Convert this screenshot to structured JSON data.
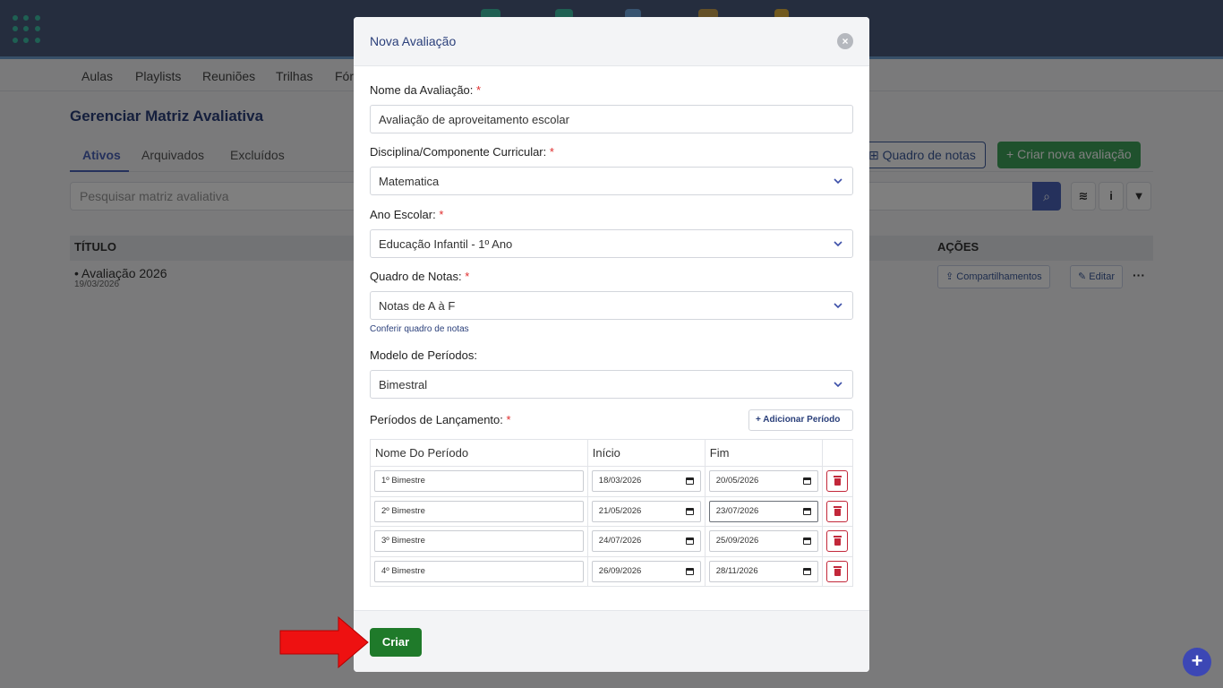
{
  "background": {
    "subnav": [
      "Aulas",
      "Playlists",
      "Reuniões",
      "Trilhas",
      "Fór"
    ],
    "page_title": "Gerenciar Matriz Avaliativa",
    "tabs": [
      "Ativos",
      "Arquivados",
      "Excluídos"
    ],
    "buttons": {
      "grade_board": "Quadro de notas",
      "create_new": "Criar nova avaliação"
    },
    "search_placeholder": "Pesquisar matriz avaliativa",
    "table": {
      "col_title": "TÍTULO",
      "col_actions": "AÇÕES",
      "rows": [
        {
          "title": "Avaliação 2026",
          "date": "19/03/2026",
          "share": "Compartilhamentos",
          "edit": "Editar"
        }
      ]
    }
  },
  "modal": {
    "title": "Nova Avaliação",
    "fields": {
      "name": {
        "label": "Nome da Avaliação:",
        "value": "Avaliação de aproveitamento escolar"
      },
      "discipline": {
        "label": "Disciplina/Componente Curricular:",
        "value": "Matematica"
      },
      "grade": {
        "label": "Ano Escolar:",
        "value": "Educação Infantil - 1º Ano"
      },
      "grade_board": {
        "label": "Quadro de Notas:",
        "value": "Notas de A à F",
        "link": "Conferir quadro de notas"
      },
      "period_model": {
        "label": "Modelo de Períodos:",
        "value": "Bimestral"
      }
    },
    "periods": {
      "label": "Períodos de Lançamento:",
      "add_button": "Adicionar Período",
      "headers": [
        "Nome Do Período",
        "Início",
        "Fim"
      ],
      "rows": [
        {
          "name": "1º Bimestre",
          "start": "18/03/2026",
          "end": "20/05/2026"
        },
        {
          "name": "2º Bimestre",
          "start": "21/05/2026",
          "end": "23/07/2026"
        },
        {
          "name": "3º Bimestre",
          "start": "24/07/2026",
          "end": "25/09/2026"
        },
        {
          "name": "4º Bimestre",
          "start": "26/09/2026",
          "end": "28/11/2026"
        }
      ]
    },
    "submit": "Criar"
  },
  "colors": {
    "primary": "#4a63b8",
    "success": "#1f7a2a",
    "danger": "#c2283a",
    "header": "#4a5b7d"
  }
}
